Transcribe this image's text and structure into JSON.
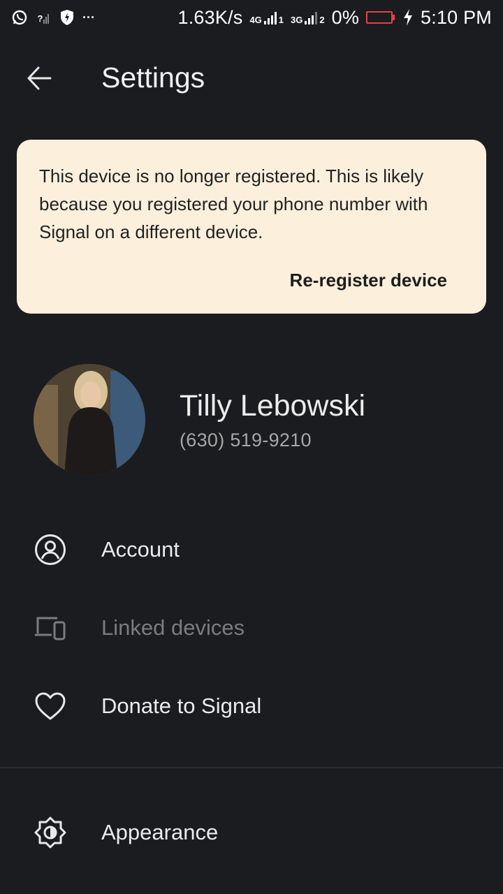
{
  "status_bar": {
    "network_speed": "1.63K/s",
    "sim1_type": "4G",
    "sim1_slot": "1",
    "sim2_type": "3G",
    "sim2_slot": "2",
    "battery": "0%",
    "time": "5:10 PM",
    "more": "···",
    "unknown_signal": "?"
  },
  "app_bar": {
    "title": "Settings"
  },
  "notice": {
    "message": "This device is no longer registered. This is likely because you registered your phone number with Signal on a different device.",
    "action_label": "Re-register device"
  },
  "profile": {
    "name": "Tilly Lebowski",
    "phone": "(630) 519-9210"
  },
  "menu": {
    "account": "Account",
    "linked_devices": "Linked devices",
    "donate": "Donate to Signal",
    "appearance": "Appearance"
  },
  "colors": {
    "background": "#1b1c1f",
    "notice_background": "#fcf0dc",
    "battery_low": "#e2414a"
  }
}
